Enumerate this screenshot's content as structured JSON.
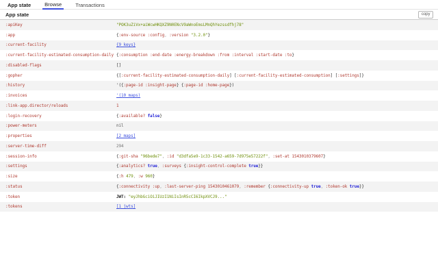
{
  "tabs": [
    {
      "label": "App state",
      "active": false,
      "bold": true
    },
    {
      "label": "Browse",
      "active": true,
      "bold": false
    },
    {
      "label": "Transactions",
      "active": false,
      "bold": false
    }
  ],
  "header": {
    "title": "App state",
    "copy_label": "copy"
  },
  "colors": {
    "accent_blue": "#3c4fde",
    "keyword_red": "#b03a30",
    "string_green": "#6f8f0b",
    "boolean_blue": "#1f1fd6",
    "row_stripe": "#f3f3f3"
  },
  "rows": [
    {
      "key": ":apiKey",
      "segments": [
        [
          "\"POK3uZiVx+aiWcwHKQXZ9N0ENcV9aWnoEmsLMnQhYezssdfhj78\"",
          "s"
        ]
      ]
    },
    {
      "key": ":app",
      "segments": [
        [
          "{",
          "p"
        ],
        [
          ":env-source :config",
          "k"
        ],
        [
          ", ",
          "c"
        ],
        [
          ":version ",
          "k"
        ],
        [
          "\"3.2.0\"",
          "s"
        ],
        [
          "}",
          "p"
        ]
      ]
    },
    {
      "key": ":current-facility",
      "segments": [
        [
          "{9 keys}",
          "l"
        ]
      ]
    },
    {
      "key": ":current-facility-estimated-consumption-daily",
      "segments": [
        [
          "{",
          "p"
        ],
        [
          ":consumption :end-date :energy-breakdown :from :interval :start-date :to",
          "k"
        ],
        [
          "}",
          "p"
        ]
      ]
    },
    {
      "key": ":disabled-flags",
      "segments": [
        [
          "[]",
          "p"
        ]
      ]
    },
    {
      "key": ":gopher",
      "segments": [
        [
          "{[",
          "p"
        ],
        [
          ":current-facility-estimated-consumption-daily",
          "k"
        ],
        [
          "] [",
          "p"
        ],
        [
          ":current-facility-estimated-consumption",
          "k"
        ],
        [
          "] [",
          "p"
        ],
        [
          ":settings",
          "k"
        ],
        [
          "]}",
          "p"
        ]
      ]
    },
    {
      "key": ":history",
      "segments": [
        [
          "'({",
          "p"
        ],
        [
          ":page-id :insight-page",
          "k"
        ],
        [
          "} {",
          "p"
        ],
        [
          ":page-id :home-page",
          "k"
        ],
        [
          "})",
          "p"
        ]
      ]
    },
    {
      "key": ":invoices",
      "segments": [
        [
          "'(10 maps)",
          "l"
        ]
      ]
    },
    {
      "key": ":link-app.director/reloads",
      "segments": [
        [
          "1",
          "n"
        ]
      ]
    },
    {
      "key": ":login-recovery",
      "segments": [
        [
          "{",
          "p"
        ],
        [
          ":available? ",
          "k"
        ],
        [
          "false",
          "b"
        ],
        [
          "}",
          "p"
        ]
      ]
    },
    {
      "key": ":power-meters",
      "segments": [
        [
          "nil",
          "nil"
        ]
      ]
    },
    {
      "key": ":properties",
      "segments": [
        [
          "[2 maps]",
          "l"
        ]
      ]
    },
    {
      "key": ":server-time-diff",
      "segments": [
        [
          "294",
          "g"
        ]
      ]
    },
    {
      "key": ":session-info",
      "segments": [
        [
          "{",
          "p"
        ],
        [
          ":git-sha ",
          "k"
        ],
        [
          "\"96bede7\"",
          "s"
        ],
        [
          ", ",
          "c"
        ],
        [
          ":id ",
          "k"
        ],
        [
          "\"d3dfa5e9-1c33-1542-a659-7d975e57222f\"",
          "s"
        ],
        [
          ", ",
          "c"
        ],
        [
          ":set-at ",
          "k"
        ],
        [
          "1543010379607",
          "n"
        ],
        [
          "}",
          "p"
        ]
      ]
    },
    {
      "key": ":settings",
      "segments": [
        [
          "{",
          "p"
        ],
        [
          ":analytics? ",
          "k"
        ],
        [
          "true",
          "b"
        ],
        [
          ", ",
          "c"
        ],
        [
          ":surveys ",
          "k"
        ],
        [
          "{",
          "p"
        ],
        [
          ":insight-control-complete ",
          "k"
        ],
        [
          "true",
          "b"
        ],
        [
          "}}",
          "p"
        ]
      ]
    },
    {
      "key": ":size",
      "segments": [
        [
          "{",
          "p"
        ],
        [
          ":h ",
          "k"
        ],
        [
          "479",
          "s"
        ],
        [
          ", ",
          "c"
        ],
        [
          ":w ",
          "k"
        ],
        [
          "960",
          "s"
        ],
        [
          "}",
          "p"
        ]
      ]
    },
    {
      "key": ":status",
      "segments": [
        [
          "{",
          "p"
        ],
        [
          ":connectivity :up",
          "k"
        ],
        [
          ", ",
          "c"
        ],
        [
          ":last-server-ping ",
          "k"
        ],
        [
          "1543010461079",
          "n"
        ],
        [
          ", ",
          "c"
        ],
        [
          ":remember ",
          "k"
        ],
        [
          "{",
          "p"
        ],
        [
          ":connectivity-up ",
          "k"
        ],
        [
          "true",
          "b"
        ],
        [
          ", ",
          "c"
        ],
        [
          ":token-ok ",
          "k"
        ],
        [
          "true",
          "b"
        ],
        [
          "}}",
          "p"
        ]
      ]
    },
    {
      "key": ":token",
      "segments": [
        [
          "JWT:",
          "jwt"
        ],
        [
          " ",
          "p"
        ],
        [
          "\"eyJhbGciOiJIUzI1NiIsInR5cCI6IkpXVCJ9...\"",
          "s"
        ]
      ]
    },
    {
      "key": ":tokens",
      "segments": [
        [
          "[1 jwts]",
          "l"
        ]
      ]
    }
  ]
}
